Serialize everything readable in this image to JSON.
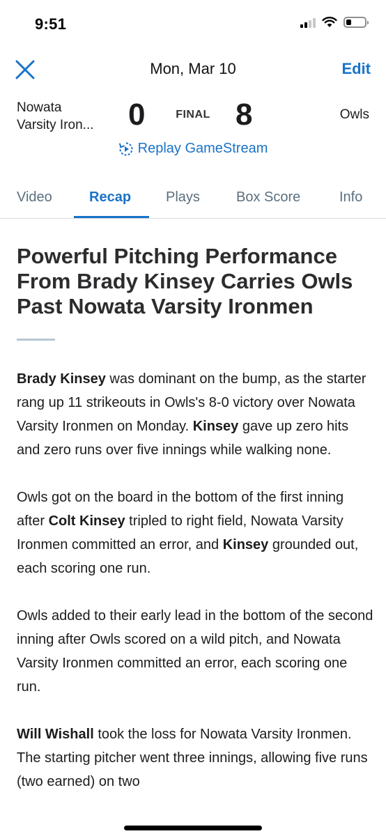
{
  "status_bar": {
    "time": "9:51",
    "icons": [
      "cellular-signal-icon",
      "wifi-icon",
      "battery-icon"
    ]
  },
  "nav": {
    "close_icon": "close-icon",
    "title": "Mon, Mar 10",
    "edit_label": "Edit"
  },
  "game": {
    "away_team_line1": "Nowata",
    "away_team_line2": "Varsity Iron...",
    "away_score": "0",
    "status": "FINAL",
    "home_score": "8",
    "home_team": "Owls",
    "replay_label": "Replay GameStream",
    "replay_icon": "replay-icon"
  },
  "tabs": [
    {
      "label": "Video",
      "active": false
    },
    {
      "label": "Recap",
      "active": true
    },
    {
      "label": "Plays",
      "active": false
    },
    {
      "label": "Box Score",
      "active": false
    },
    {
      "label": "Info",
      "active": false
    }
  ],
  "article": {
    "headline": "Powerful Pitching Performance From Brady Kinsey Carries Owls Past Nowata Varsity Ironmen",
    "paragraphs": [
      [
        {
          "text": "Brady Kinsey",
          "bold": true
        },
        {
          "text": " was dominant on the bump, as the starter rang up 11 strikeouts in Owls's 8-0 victory over Nowata Varsity Ironmen on Monday. ",
          "bold": false
        },
        {
          "text": "Kinsey",
          "bold": true
        },
        {
          "text": " gave up zero hits and zero runs over five innings while walking none.",
          "bold": false
        }
      ],
      [
        {
          "text": "Owls got on the board in the bottom of the first inning after ",
          "bold": false
        },
        {
          "text": "Colt Kinsey",
          "bold": true
        },
        {
          "text": " tripled to right field, Nowata Varsity Ironmen committed an error, and ",
          "bold": false
        },
        {
          "text": "Kinsey",
          "bold": true
        },
        {
          "text": " grounded out, each scoring one run.",
          "bold": false
        }
      ],
      [
        {
          "text": "Owls added to their early lead in the bottom of the second inning after Owls scored on a wild pitch, and Nowata Varsity Ironmen committed an error, each scoring one run.",
          "bold": false
        }
      ],
      [
        {
          "text": "Will Wishall",
          "bold": true
        },
        {
          "text": " took the loss for Nowata Varsity Ironmen. The starting pitcher went three innings, allowing five runs (two earned) on two",
          "bold": false
        }
      ]
    ]
  },
  "colors": {
    "accent": "#1a73c8",
    "tab_inactive": "#5a6f7f",
    "divider": "#b7c7d4"
  }
}
